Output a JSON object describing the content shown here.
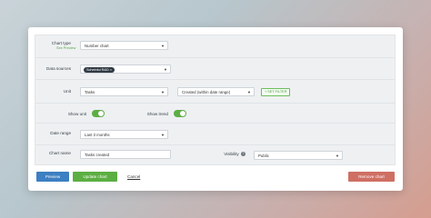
{
  "form": {
    "chart_type": {
      "label": "Chart type",
      "sublink": "See Preview",
      "value": "Number chart"
    },
    "data_sources": {
      "label": "Data sources",
      "tag": "Scheinful R&D",
      "tag_remove": "×"
    },
    "unit": {
      "label": "Unit",
      "value": "Tasks",
      "date_value": "Created (within date range)",
      "set_filter": "SET FILTER"
    },
    "show_unit": {
      "label": "Show unit",
      "on": true
    },
    "show_trend": {
      "label": "Show trend",
      "on": true
    },
    "date_range": {
      "label": "Date range",
      "value": "Last 3 months"
    },
    "chart_name": {
      "label": "Chart name",
      "value": "Tasks created"
    },
    "visibility": {
      "label": "Visibility",
      "help": "?",
      "value": "Public"
    }
  },
  "footer": {
    "preview": "Preview",
    "update": "Update chart",
    "cancel": "Cancel",
    "remove": "Remove chart"
  },
  "colors": {
    "preview": "#3c7fc2",
    "update": "#5cae43",
    "remove": "#cf6f63",
    "toggle": "#5cae43"
  },
  "icons": {
    "chevron": "chevron-down-icon",
    "filter": "plus-icon"
  }
}
